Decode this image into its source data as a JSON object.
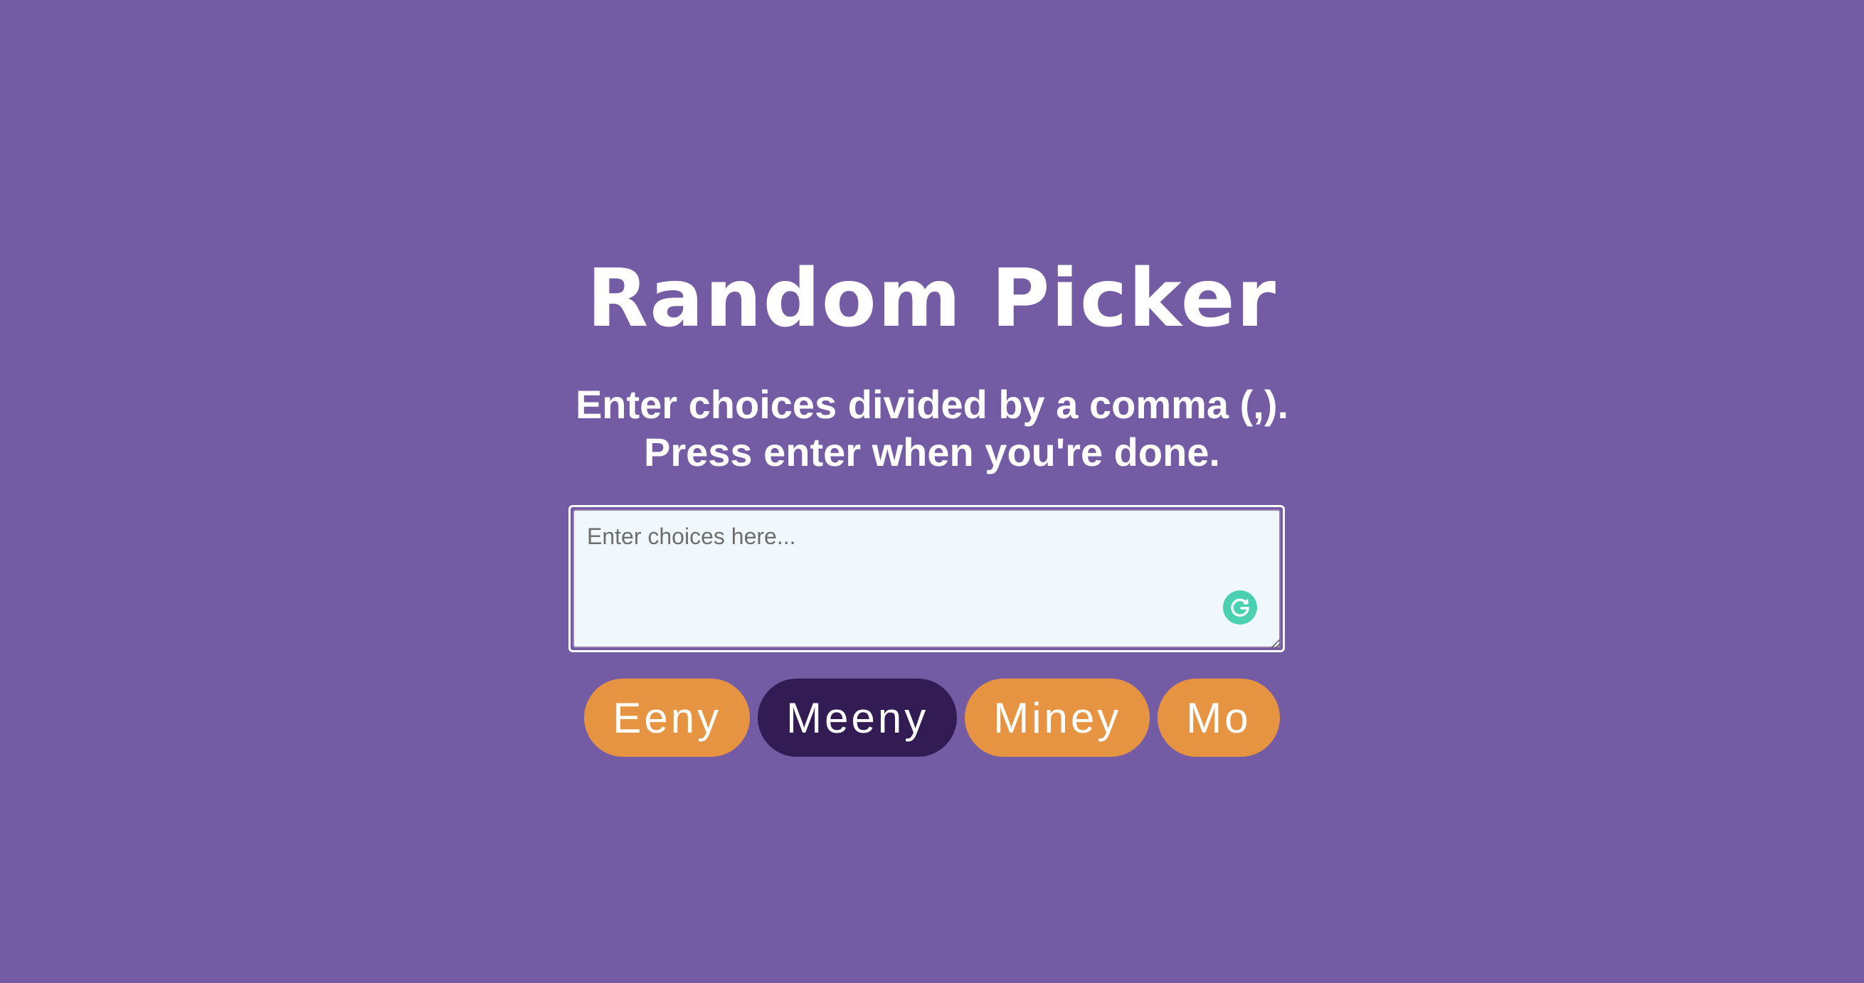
{
  "header": {
    "title": "Random Picker"
  },
  "instructions": {
    "line1": "Enter choices divided by a comma (,).",
    "line2": "Press enter when you're done."
  },
  "input": {
    "placeholder": "Enter choices here...",
    "value": ""
  },
  "tags": [
    {
      "label": "Eeny",
      "highlighted": false
    },
    {
      "label": "Meeny",
      "highlighted": true
    },
    {
      "label": "Miney",
      "highlighted": false
    },
    {
      "label": "Mo",
      "highlighted": false
    }
  ],
  "icons": {
    "assistant": "grammarly-icon"
  },
  "colors": {
    "background": "#735ca3",
    "tag": "#e69442",
    "tag_highlight": "#331c54",
    "input_background": "#f0f7fd"
  }
}
